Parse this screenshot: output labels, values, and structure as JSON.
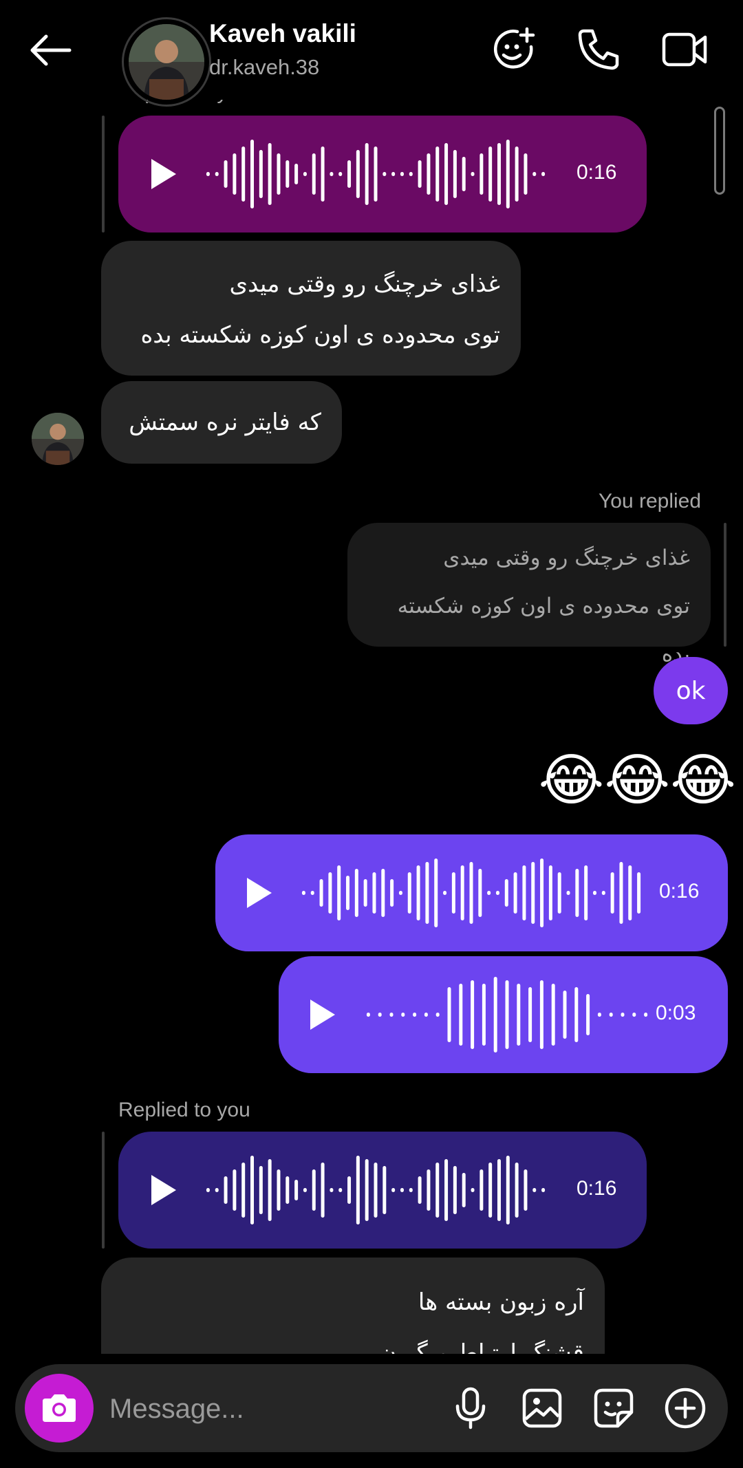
{
  "header": {
    "back_icon": "back-arrow-icon",
    "contact_name": "Kaveh vakili",
    "contact_handle": "dr.kaveh.38",
    "actions": [
      "ai-sticker-icon",
      "phone-icon",
      "video-call-icon"
    ]
  },
  "messages": {
    "partial_label": "Replied to you",
    "voice1_duration": "0:16",
    "incoming_lines_1": [
      "غذای خرچنگ رو وقتی میدی",
      "توی محدوده ی اون کوزه شکسته بده"
    ],
    "incoming_2": "که فایتر نره سمتش",
    "you_replied_label": "You replied",
    "quoted_lines": [
      "غذای خرچنگ رو وقتی میدی",
      "توی محدوده ی اون کوزه شکسته بده"
    ],
    "ok_text": "ok",
    "emojis": "😂😂😂",
    "voice2_duration": "0:16",
    "voice3_duration": "0:03",
    "replied_to_you_label": "Replied to you",
    "voice4_duration": "0:16",
    "incoming_lines_3": [
      "آره زبون بسته ها",
      "قشنگ ارتباط میگیرن"
    ]
  },
  "colors": {
    "voice1": "#6a0a64",
    "voice2": "#6c44f0",
    "voice3": "#6c44f0",
    "voice4": "#2e1f7a",
    "ok_bubble": "#7c3aed",
    "camera": "#c51cd3"
  },
  "composer": {
    "placeholder": "Message...",
    "icons": [
      "camera-icon",
      "microphone-icon",
      "gallery-icon",
      "sticker-icon",
      "add-icon"
    ]
  }
}
